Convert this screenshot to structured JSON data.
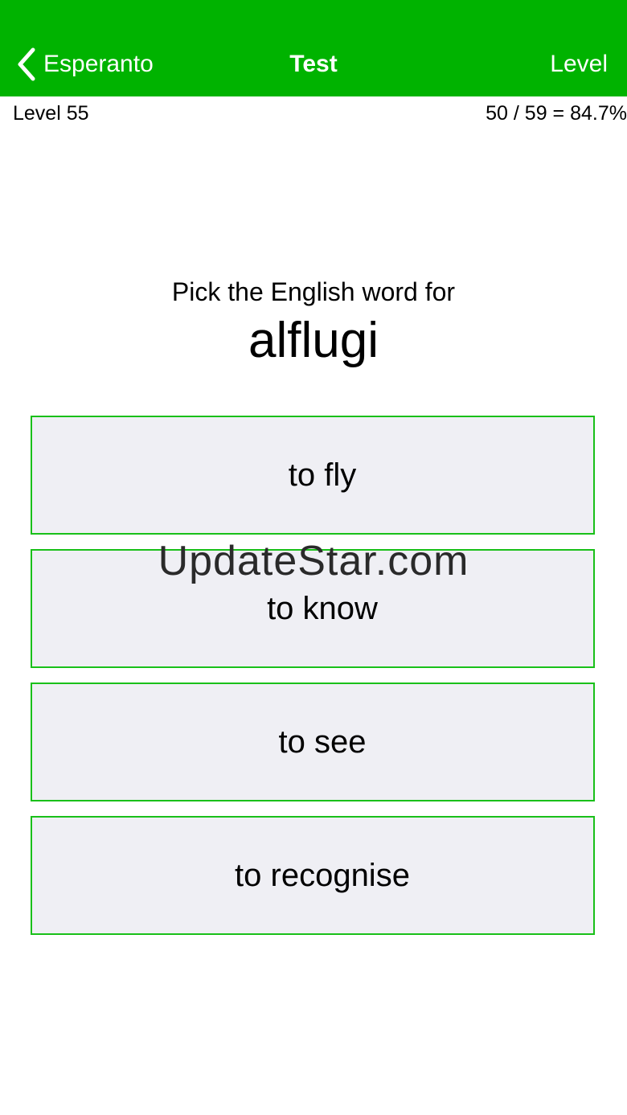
{
  "navbar": {
    "back_label": "Esperanto",
    "title": "Test",
    "right_label": "Level",
    "color": "#00b300",
    "back_icon": "chevron-left-icon"
  },
  "status": {
    "level": "Level 55",
    "score": "50 / 59 = 84.7%"
  },
  "question": {
    "prompt": "Pick the English word for",
    "word": "alflugi"
  },
  "options": [
    {
      "label": "to fly"
    },
    {
      "label": "to know"
    },
    {
      "label": "to see"
    },
    {
      "label": "to recognise"
    }
  ],
  "watermark": "UpdateStar.com"
}
